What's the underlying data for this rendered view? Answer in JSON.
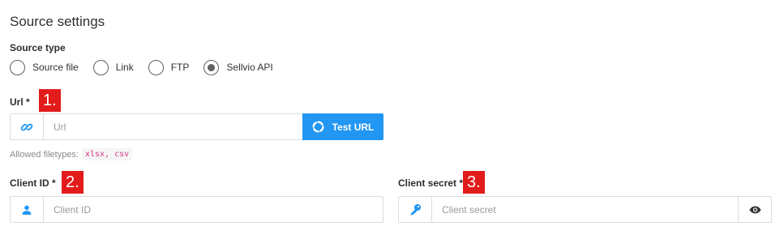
{
  "section_title": "Source settings",
  "source_type": {
    "label": "Source type",
    "options": [
      {
        "label": "Source file",
        "checked": false
      },
      {
        "label": "Link",
        "checked": false
      },
      {
        "label": "FTP",
        "checked": false
      },
      {
        "label": "Sellvio API",
        "checked": true
      }
    ]
  },
  "url": {
    "label": "Url *",
    "badge": "1.",
    "placeholder": "Url",
    "value": "",
    "test_button": "Test URL",
    "allowed_label": "Allowed filetypes:",
    "allowed_types": "xlsx, csv"
  },
  "client_id": {
    "label": "Client ID *",
    "badge": "2.",
    "placeholder": "Client ID",
    "value": ""
  },
  "client_secret": {
    "label": "Client secret *",
    "badge": "3.",
    "placeholder": "Client secret",
    "value": ""
  },
  "colors": {
    "accent": "#2196f3",
    "badge": "#e21b1b",
    "code": "#d63384"
  },
  "icons": [
    "link-icon",
    "spinner-icon",
    "user-icon",
    "key-icon",
    "eye-icon"
  ]
}
